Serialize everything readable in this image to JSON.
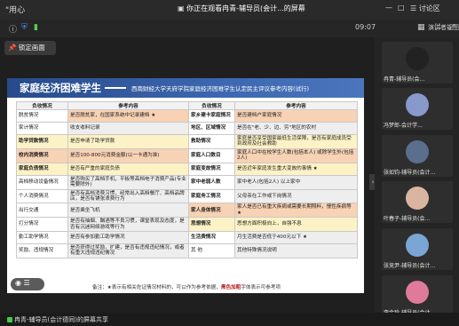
{
  "topbar": {
    "left_text": "\"用心",
    "notice": "你正在观看冉青-辅导员(会计...的屏幕",
    "window_controls": [
      "—",
      "□"
    ],
    "meeting_label": "讨论区"
  },
  "toolbar2": {
    "time": "09:07",
    "speaker_view_label": "演讲者视图"
  },
  "pin_button": "锁定画面",
  "slide": {
    "title": "家庭经济困难学生",
    "subtitle": "西南财经大学天府学院家庭经济困难学生认定民主评议参考内容(试行)",
    "headers": [
      "负收情况",
      "参考内容",
      "负收情况",
      "参考内容"
    ],
    "rows": [
      [
        "脱贫情况",
        "是否脱贫家，在国家系统中记录建档 ★",
        "家乡建卡家庭情况",
        "是否建档户家庭情况"
      ],
      [
        "家计情况",
        "收支收料记录",
        "地区、区域情况",
        "是否在\"老、少、边、穷\"地区的农村"
      ],
      [
        "助学贷款情况",
        "是否申请了助学贷款",
        "救助情况",
        "家庭是否享受国家最低生活保障，是否有家庭成员受到政府及社会救助"
      ],
      [
        "校内消费情况",
        "是否100-800元消费金额(以一卡通为准)",
        "家庭人口数目",
        "家庭人口中在校学生人数(包括本人) 或除学生外(包括2人)"
      ],
      [
        "家庭负债情况",
        "是否有严重的家庭负债",
        "家庭变故情况",
        "是否近年家庭发生重大变故的事情 ★"
      ],
      [
        "高档移动设备情况",
        "是否购买了高档手机，平板等高档电子消费产品(专业需要除外)",
        "家中老弱人数",
        "家中老人(包括2人) 以上家中"
      ],
      [
        "个人消费情况",
        "是否有高档消费习惯，经常出入高档餐厅、高档品牌店，是否有铺张浪费行为",
        "家庭务工情况",
        "父母亲在工作或下岗情况"
      ],
      [
        "出行交通",
        "是否乘坐飞机",
        "家人身体情况",
        "家人是否已有重大疾病或需要长期照料，慢性疾病等 ★"
      ],
      [
        "打分情况",
        "是否有抽烟、酗酒等不良习惯，课堂表现及态度，是否有沉迷网络游戏等行为",
        "思想情况",
        "思想方面积极向上，自强不息"
      ],
      [
        "勤工助学情况",
        "是否有参加勤工助学情况",
        "生活费情况",
        "月生活费是否低于400元以下 ★"
      ],
      [
        "奖励、违规情况",
        "是否获得过奖励，扩建，是否有违规违纪情况，或者有重大违规违纪情况",
        "其 他",
        "其他特殊情况说明"
      ]
    ],
    "note_prefix": "备注：",
    "note_star": "★",
    "note_text": "表示有相关佐证情况材料的，可以作为参考依据，",
    "note_red": "黑色加粗",
    "note_suffix": "字体表示可参考项"
  },
  "participants": [
    {
      "name": "冉青-辅导员(会...",
      "avatar_color": "#222222"
    },
    {
      "name": "冯梦郎-会计学...",
      "avatar_color": "#8899cc"
    },
    {
      "name": "张如钧-辅导员(会计...",
      "avatar_color": "#5a6f8c"
    },
    {
      "name": "叶春子-辅导员(会...",
      "avatar_color": "#d9b5a0"
    },
    {
      "name": "张竞尹-辅导员(会计...",
      "avatar_color": "#7aa6d6"
    },
    {
      "name": "李金玲-辅导员(会计...",
      "avatar_color": "#e07a9a"
    }
  ],
  "bottombar": {
    "share_text": "冉青-辅导员(会计德同)的屏幕共享"
  }
}
